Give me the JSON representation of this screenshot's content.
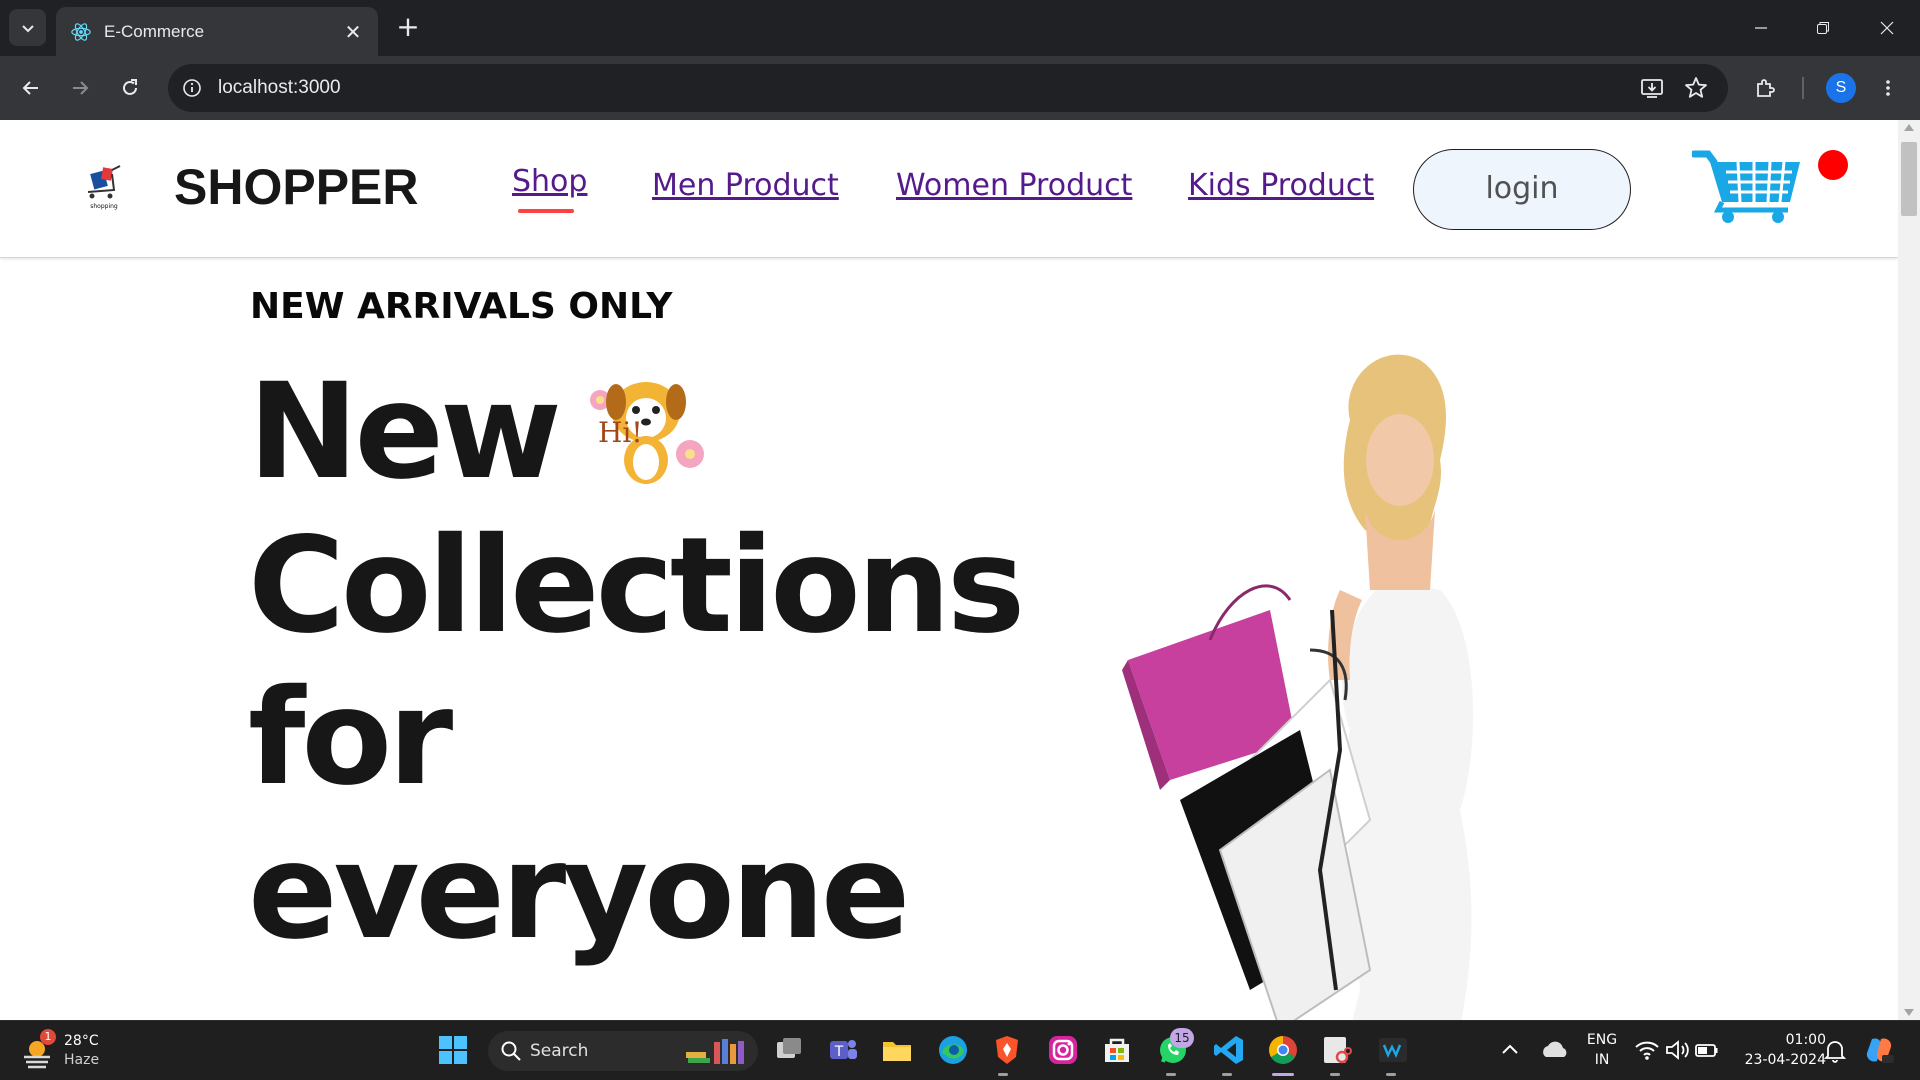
{
  "browser": {
    "tab_title": "E-Commerce",
    "url": "localhost:3000",
    "profile_initial": "S"
  },
  "navbar": {
    "logo_caption": "shopping",
    "brand": "SHOPPER",
    "links": [
      "Shop",
      "Men Product",
      "Women Product",
      "Kids Product"
    ],
    "active_link": "Shop",
    "login_label": "login",
    "cart_color": "#1aa7e6",
    "accent_color": "#ff4141"
  },
  "hero": {
    "kicker": "NEW ARRIVALS ONLY",
    "lines": [
      "New",
      "Collections",
      "for",
      "everyone"
    ],
    "sticker_text": "Hi!"
  },
  "taskbar": {
    "weather_temp": "28°C",
    "weather_desc": "Haze",
    "weather_badge": "1",
    "search_label": "Search",
    "whatsapp_badge": "15",
    "language": "ENG",
    "region": "IN",
    "time": "01:00",
    "date": "23-04-2024"
  }
}
